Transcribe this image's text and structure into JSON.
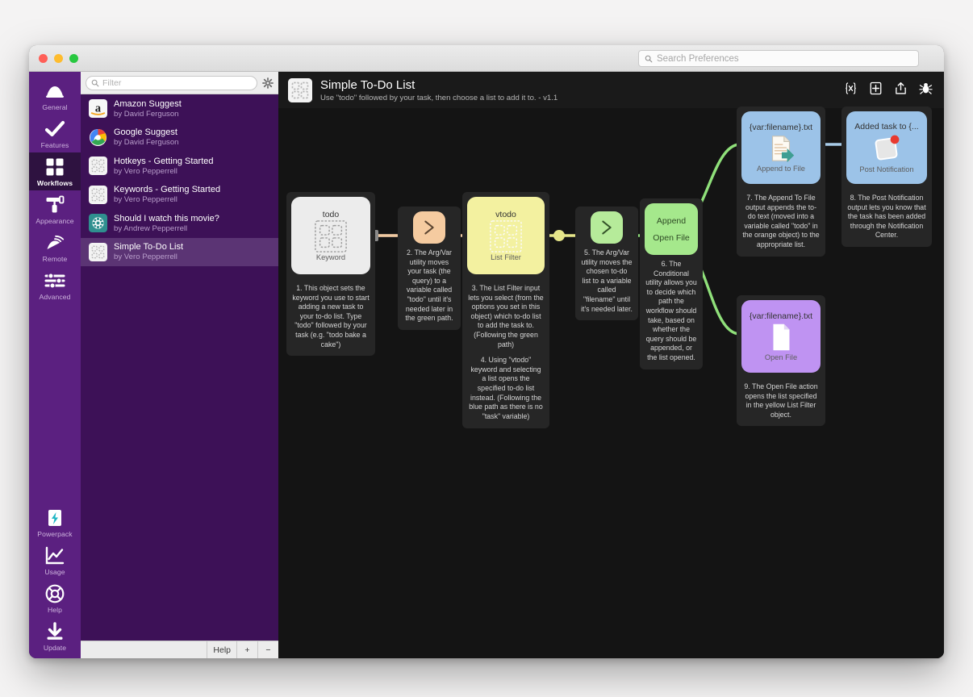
{
  "window": {
    "search": {
      "placeholder": "Search Preferences",
      "icon": "search-icon"
    },
    "traffic": [
      "close",
      "minimize",
      "zoom"
    ]
  },
  "sidebar": {
    "items": [
      {
        "label": "General",
        "icon": "hat-icon",
        "active": false
      },
      {
        "label": "Features",
        "icon": "check-icon",
        "active": false
      },
      {
        "label": "Workflows",
        "icon": "grid-icon",
        "active": true
      },
      {
        "label": "Appearance",
        "icon": "paintroller-icon",
        "active": false
      },
      {
        "label": "Remote",
        "icon": "remote-icon",
        "active": false
      },
      {
        "label": "Advanced",
        "icon": "sliders-icon",
        "active": false
      }
    ],
    "bottom_items": [
      {
        "label": "Powerpack",
        "icon": "bolt-icon"
      },
      {
        "label": "Usage",
        "icon": "chart-icon"
      },
      {
        "label": "Help",
        "icon": "lifering-icon"
      },
      {
        "label": "Update",
        "icon": "download-icon"
      }
    ]
  },
  "workflow_list": {
    "filter": {
      "placeholder": "Filter",
      "value": "",
      "icon": "search-icon"
    },
    "gear_icon": "gear-icon",
    "items": [
      {
        "name": "Amazon Suggest",
        "author": "by David Ferguson",
        "icon": "amazon-icon",
        "selected": false
      },
      {
        "name": "Google Suggest",
        "author": "by David Ferguson",
        "icon": "google-icon",
        "selected": false
      },
      {
        "name": "Hotkeys - Getting Started",
        "author": "by Vero Pepperrell",
        "icon": "grid-icon",
        "selected": false
      },
      {
        "name": "Keywords - Getting Started",
        "author": "by Vero Pepperrell",
        "icon": "grid-icon",
        "selected": false
      },
      {
        "name": "Should I watch this movie?",
        "author": "by Andrew Pepperrell",
        "icon": "film-icon",
        "selected": false
      },
      {
        "name": "Simple To-Do List",
        "author": "by Vero Pepperrell",
        "icon": "grid-icon",
        "selected": true
      }
    ],
    "footer": {
      "help": "Help",
      "add": "+",
      "remove": "−"
    }
  },
  "workflow_header": {
    "title": "Simple To-Do List",
    "subtitle": "Use \"todo\" followed by your task, then choose a list to add it to. - v1.1",
    "icon": "workflow-grid-icon",
    "tools": [
      {
        "name": "variables-icon",
        "glyph": "[x]"
      },
      {
        "name": "add-object-icon",
        "glyph": "add"
      },
      {
        "name": "share-export-icon",
        "glyph": "share"
      },
      {
        "name": "debug-icon",
        "glyph": "bug"
      }
    ]
  },
  "nodes": [
    {
      "id": "keyword",
      "title": "todo",
      "subtitle": "Keyword",
      "glyph": "grid-dashed-icon",
      "color": "#ececec",
      "note": [
        "1. This object sets the keyword you use to start adding a new task to your to-do list. Type \"todo\" followed by your task (e.g. \"todo bake a cake\")"
      ]
    },
    {
      "id": "argvar-todo",
      "title": "",
      "subtitle": "",
      "glyph": "chevron-right-icon",
      "color": "#f5cba0",
      "note": [
        "2. The Arg/Var utility moves your task (the query) to a variable called \"todo\" until it's needed later in the green path."
      ]
    },
    {
      "id": "list-filter",
      "title": "vtodo",
      "subtitle": "List Filter",
      "glyph": "grid-dashed-icon",
      "color": "#f3f1a0",
      "note": [
        "3. The List Filter input lets you select (from the options you set in this object) which to-do list to add the task to. (Following the green path)",
        "4. Using \"vtodo\" keyword and selecting a list opens the specified to-do list instead. (Following the blue path as there is no \"task\" variable)"
      ]
    },
    {
      "id": "argvar-filename",
      "title": "",
      "subtitle": "",
      "glyph": "chevron-right-icon",
      "color": "#b6eb9a",
      "note": [
        "5. The Arg/Var utility moves the chosen to-do list to a variable called \"filename\" until it's needed later."
      ]
    },
    {
      "id": "conditional",
      "title": "Append",
      "subtitle": "Open File",
      "glyph": "two-line-icon",
      "color": "#a5e88c",
      "note": [
        "6. The Conditional utility allows you to decide which path the workflow should take, based on whether the query should be appended, or the list opened."
      ]
    },
    {
      "id": "append-to-file",
      "title": "{var:filename}.txt",
      "subtitle": "Append to File",
      "glyph": "document-arrow-icon",
      "color": "#9cc3e8",
      "note": [
        "7. The Append To File output appends the to-do text (moved into a variable called \"todo\" in the orange object) to the appropriate list."
      ]
    },
    {
      "id": "post-notification",
      "title": "Added task to {...",
      "subtitle": "Post Notification",
      "glyph": "notification-icon",
      "color": "#9cc3e8",
      "note": [
        "8. The Post Notification output lets you know that the task has been added through the Notification Center."
      ]
    },
    {
      "id": "open-file",
      "title": "{var:filename}.txt",
      "subtitle": "Open File",
      "glyph": "document-icon",
      "color": "#bf93f2",
      "note": [
        "9. The Open File action opens the list specified in the yellow List Filter object."
      ]
    }
  ],
  "colors": {
    "sidebar_purple": "#5b2080",
    "sidebar_active": "#2e1240",
    "list_purple": "#3d1157",
    "canvas": "#141414",
    "edge_gray": "#8a8a8a",
    "edge_orange": "#f5cba0",
    "edge_yellow": "#eaea86",
    "edge_green": "#8fe07a",
    "edge_blue": "#a8cbe8"
  }
}
